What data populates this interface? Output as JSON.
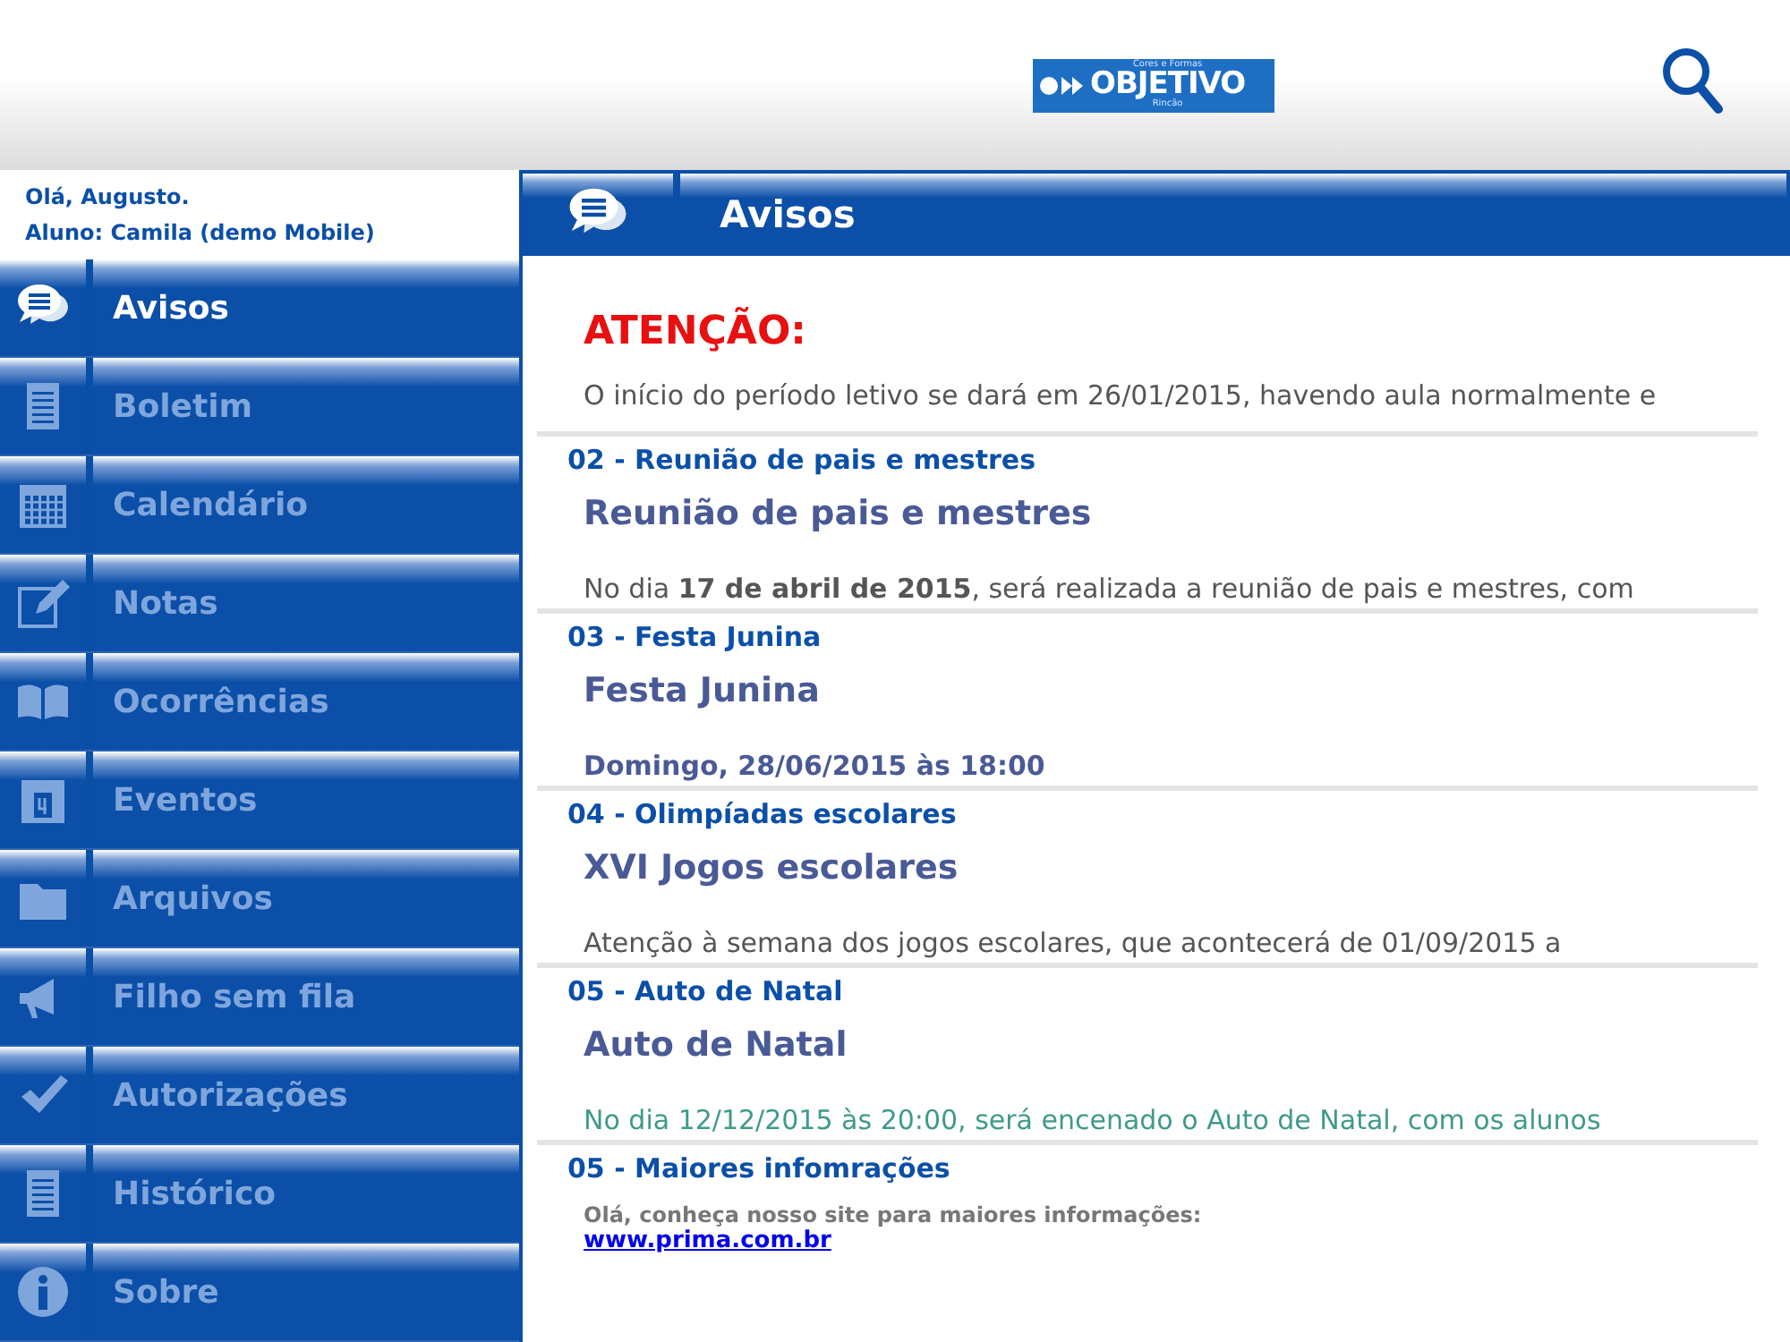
{
  "header": {
    "logo": {
      "tagline": "Cores e Formas",
      "name": "OBJETIVO",
      "place": "Rincão"
    }
  },
  "user": {
    "greeting": "Olá, Augusto.",
    "student": "Aluno: Camila (demo Mobile)"
  },
  "sidebar": {
    "items": [
      {
        "label": "Avisos",
        "selected": true
      },
      {
        "label": "Boletim",
        "selected": false
      },
      {
        "label": "Calendário",
        "selected": false
      },
      {
        "label": "Notas",
        "selected": false
      },
      {
        "label": "Ocorrências",
        "selected": false
      },
      {
        "label": "Eventos",
        "selected": false
      },
      {
        "label": "Arquivos",
        "selected": false
      },
      {
        "label": "Filho sem fila",
        "selected": false
      },
      {
        "label": "Autorizações",
        "selected": false
      },
      {
        "label": "Histórico",
        "selected": false
      },
      {
        "label": "Sobre",
        "selected": false
      }
    ]
  },
  "page": {
    "title": "Avisos"
  },
  "notices": [
    {
      "kind": "alert",
      "title": "ATENÇÃO:",
      "body": {
        "text": "O início do período letivo se dará em 26/01/2015, havendo aula normalmente e",
        "color": "#555555"
      }
    },
    {
      "kind": "normal",
      "header": "02 - Reunião de pais e mestres",
      "title": "Reunião de pais e mestres",
      "body": {
        "text": "No dia **17 de abril de 2015**, será realizada a reunião de pais e mestres, com",
        "color": "#555555"
      }
    },
    {
      "kind": "normal",
      "header": "03 - Festa Junina",
      "title": "Festa Junina",
      "body": {
        "text": "**Domingo, 28/06/2015 às 18:00**",
        "color": "#4a5a96"
      }
    },
    {
      "kind": "normal",
      "header": "04 - Olimpíadas escolares",
      "title": "XVI Jogos escolares",
      "body": {
        "text": "Atenção à semana dos jogos escolares, que acontecerá de 01/09/2015 a",
        "color": "#555555"
      }
    },
    {
      "kind": "normal",
      "header": "05 - Auto de Natal",
      "title": "Auto de Natal",
      "body": {
        "text": "No dia 12/12/2015 às 20:00, será encenado o Auto de Natal, com os alunos",
        "color": "#3f9a8a"
      }
    }
  ],
  "info": {
    "header": "05 - Maiores infomrações",
    "text": "Olá, conheça nosso site para maiores informações:",
    "link": "www.prima.com.br"
  }
}
